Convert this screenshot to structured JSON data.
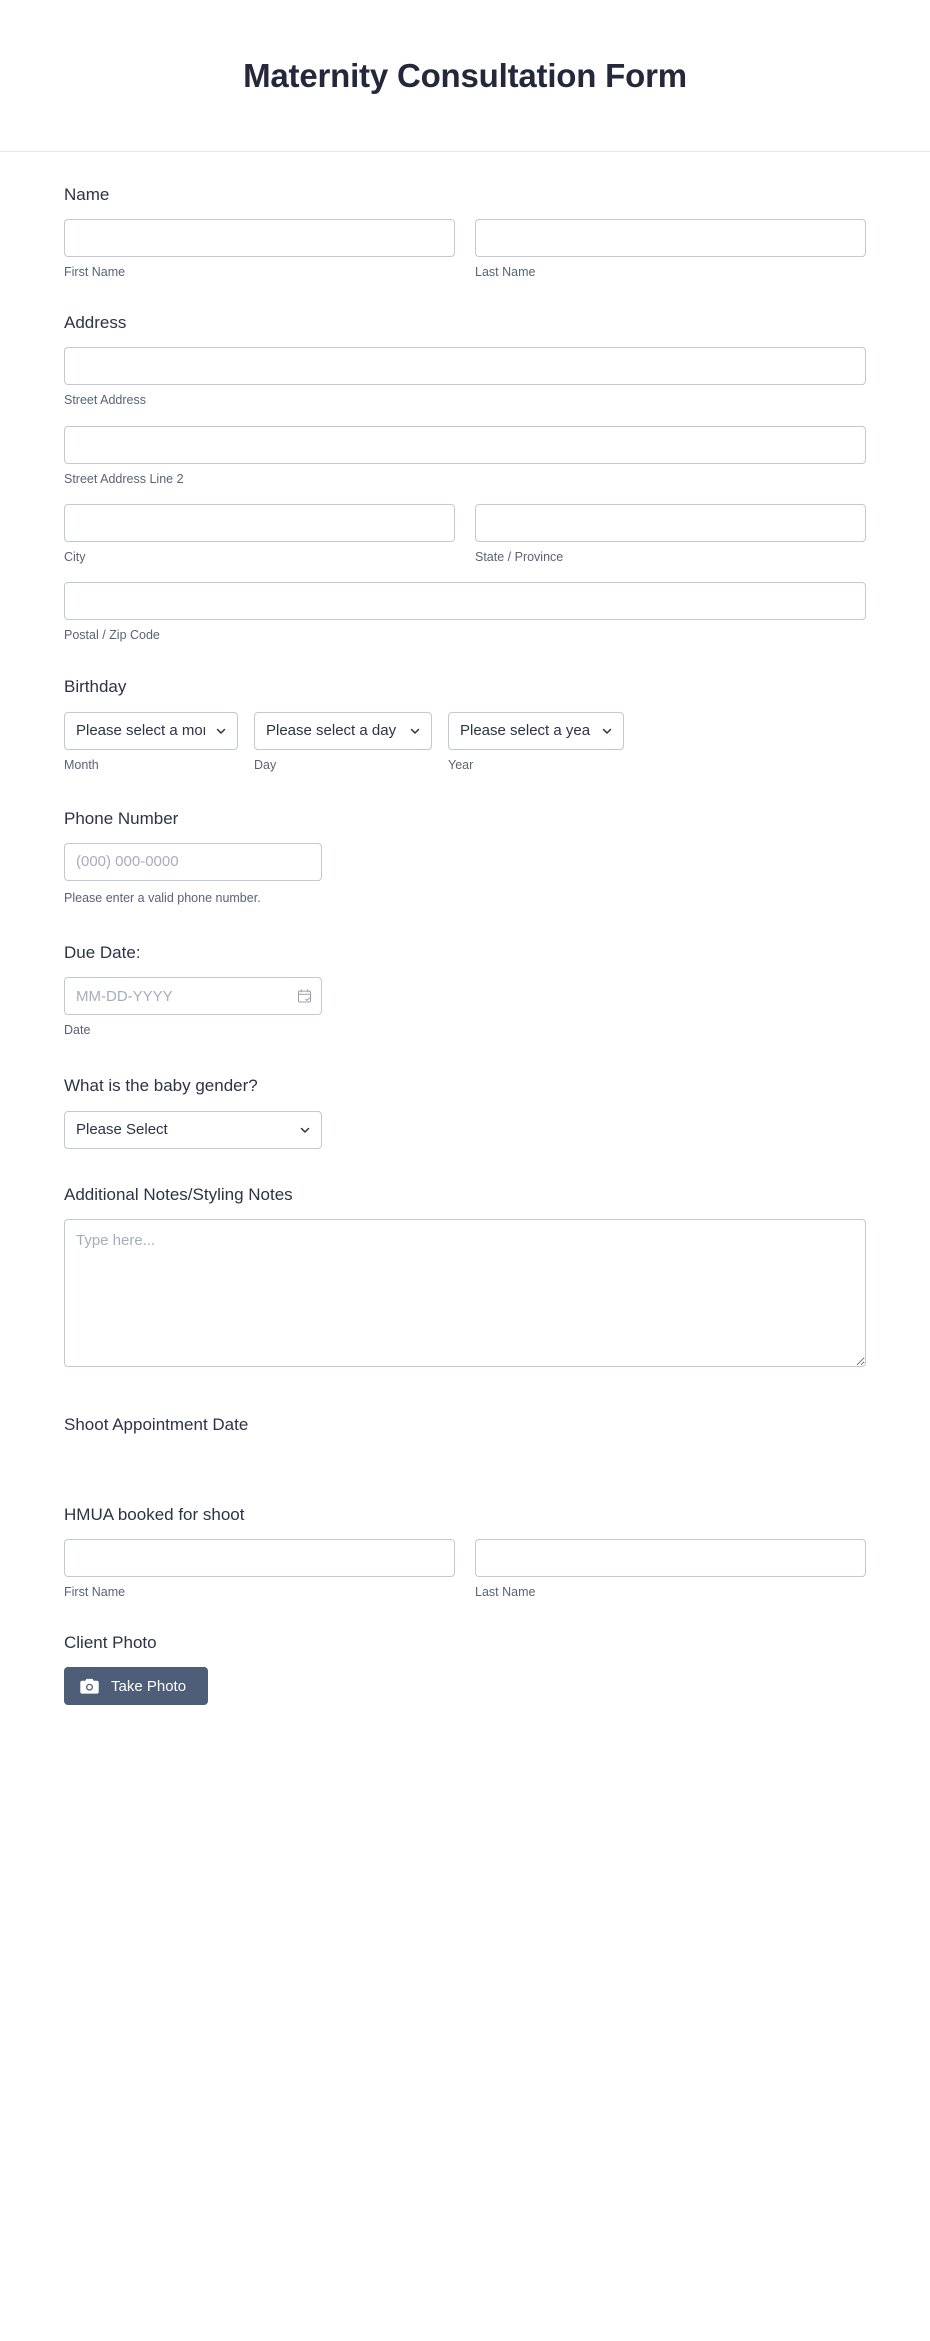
{
  "header": {
    "title": "Maternity Consultation Form"
  },
  "fields": {
    "name": {
      "label": "Name",
      "first": {
        "sub_label": "First Name",
        "value": "",
        "placeholder": ""
      },
      "last": {
        "sub_label": "Last Name",
        "value": "",
        "placeholder": ""
      }
    },
    "address": {
      "label": "Address",
      "street": {
        "sub_label": "Street Address",
        "value": "",
        "placeholder": ""
      },
      "street2": {
        "sub_label": "Street Address Line 2",
        "value": "",
        "placeholder": ""
      },
      "city": {
        "sub_label": "City",
        "value": "",
        "placeholder": ""
      },
      "state": {
        "sub_label": "State / Province",
        "value": "",
        "placeholder": ""
      },
      "postal": {
        "sub_label": "Postal / Zip Code",
        "value": "",
        "placeholder": ""
      }
    },
    "birthday": {
      "label": "Birthday",
      "month": {
        "sub_label": "Month",
        "selected": "Please select a month",
        "options": [
          "Please select a month"
        ]
      },
      "day": {
        "sub_label": "Day",
        "selected": "Please select a day",
        "options": [
          "Please select a day"
        ]
      },
      "year": {
        "sub_label": "Year",
        "selected": "Please select a year",
        "options": [
          "Please select a year"
        ]
      }
    },
    "phone": {
      "label": "Phone Number",
      "placeholder": "(000) 000-0000",
      "value": "",
      "hint": "Please enter a valid phone number."
    },
    "due_date": {
      "label": "Due Date:",
      "placeholder": "MM-DD-YYYY",
      "value": "",
      "sub_label": "Date",
      "icon": "calendar-icon"
    },
    "baby_gender": {
      "label": "What is the baby gender?",
      "selected": "Please Select",
      "options": [
        "Please Select"
      ]
    },
    "additional_notes": {
      "label": "Additional Notes/Styling Notes",
      "placeholder": "Type here...",
      "value": ""
    },
    "shoot_appointment_date": {
      "label": "Shoot Appointment Date"
    },
    "hmua": {
      "label": "HMUA booked for shoot",
      "first": {
        "sub_label": "First Name",
        "value": "",
        "placeholder": ""
      },
      "last": {
        "sub_label": "Last Name",
        "value": "",
        "placeholder": ""
      }
    },
    "client_photo": {
      "label": "Client Photo",
      "button_label": "Take Photo",
      "button_icon": "camera-icon",
      "button_color": "#4e5d78"
    }
  },
  "theme": {
    "title_color": "#23283a",
    "label_color": "#2c3345",
    "sub_label_color": "#5a6275",
    "border_color": "#c3c8d4",
    "placeholder_color": "#a5adbd",
    "accent": "#4e5d78",
    "background": "#ffffff"
  }
}
